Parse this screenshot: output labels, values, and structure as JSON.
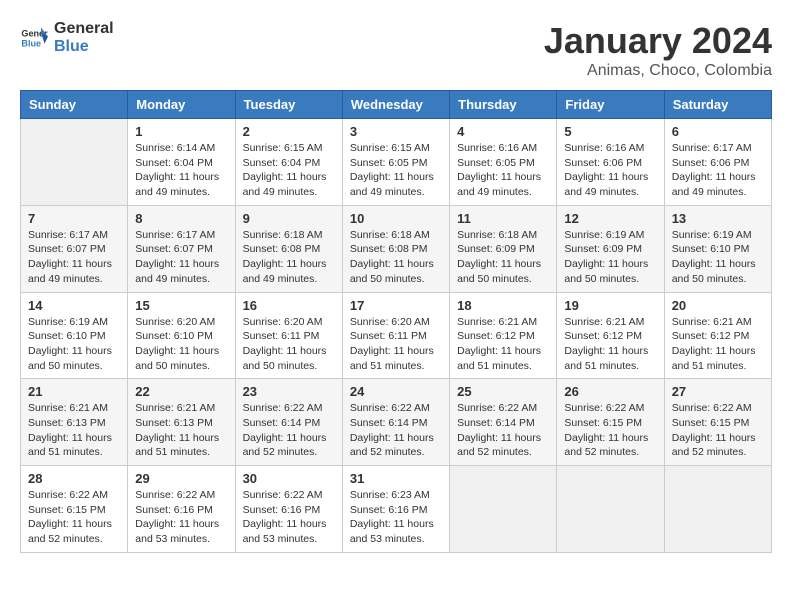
{
  "logo": {
    "text_general": "General",
    "text_blue": "Blue"
  },
  "title": "January 2024",
  "subtitle": "Animas, Choco, Colombia",
  "days_of_week": [
    "Sunday",
    "Monday",
    "Tuesday",
    "Wednesday",
    "Thursday",
    "Friday",
    "Saturday"
  ],
  "weeks": [
    [
      {
        "day": "",
        "detail": ""
      },
      {
        "day": "1",
        "detail": "Sunrise: 6:14 AM\nSunset: 6:04 PM\nDaylight: 11 hours\nand 49 minutes."
      },
      {
        "day": "2",
        "detail": "Sunrise: 6:15 AM\nSunset: 6:04 PM\nDaylight: 11 hours\nand 49 minutes."
      },
      {
        "day": "3",
        "detail": "Sunrise: 6:15 AM\nSunset: 6:05 PM\nDaylight: 11 hours\nand 49 minutes."
      },
      {
        "day": "4",
        "detail": "Sunrise: 6:16 AM\nSunset: 6:05 PM\nDaylight: 11 hours\nand 49 minutes."
      },
      {
        "day": "5",
        "detail": "Sunrise: 6:16 AM\nSunset: 6:06 PM\nDaylight: 11 hours\nand 49 minutes."
      },
      {
        "day": "6",
        "detail": "Sunrise: 6:17 AM\nSunset: 6:06 PM\nDaylight: 11 hours\nand 49 minutes."
      }
    ],
    [
      {
        "day": "7",
        "detail": "Sunrise: 6:17 AM\nSunset: 6:07 PM\nDaylight: 11 hours\nand 49 minutes."
      },
      {
        "day": "8",
        "detail": "Sunrise: 6:17 AM\nSunset: 6:07 PM\nDaylight: 11 hours\nand 49 minutes."
      },
      {
        "day": "9",
        "detail": "Sunrise: 6:18 AM\nSunset: 6:08 PM\nDaylight: 11 hours\nand 49 minutes."
      },
      {
        "day": "10",
        "detail": "Sunrise: 6:18 AM\nSunset: 6:08 PM\nDaylight: 11 hours\nand 50 minutes."
      },
      {
        "day": "11",
        "detail": "Sunrise: 6:18 AM\nSunset: 6:09 PM\nDaylight: 11 hours\nand 50 minutes."
      },
      {
        "day": "12",
        "detail": "Sunrise: 6:19 AM\nSunset: 6:09 PM\nDaylight: 11 hours\nand 50 minutes."
      },
      {
        "day": "13",
        "detail": "Sunrise: 6:19 AM\nSunset: 6:10 PM\nDaylight: 11 hours\nand 50 minutes."
      }
    ],
    [
      {
        "day": "14",
        "detail": "Sunrise: 6:19 AM\nSunset: 6:10 PM\nDaylight: 11 hours\nand 50 minutes."
      },
      {
        "day": "15",
        "detail": "Sunrise: 6:20 AM\nSunset: 6:10 PM\nDaylight: 11 hours\nand 50 minutes."
      },
      {
        "day": "16",
        "detail": "Sunrise: 6:20 AM\nSunset: 6:11 PM\nDaylight: 11 hours\nand 50 minutes."
      },
      {
        "day": "17",
        "detail": "Sunrise: 6:20 AM\nSunset: 6:11 PM\nDaylight: 11 hours\nand 51 minutes."
      },
      {
        "day": "18",
        "detail": "Sunrise: 6:21 AM\nSunset: 6:12 PM\nDaylight: 11 hours\nand 51 minutes."
      },
      {
        "day": "19",
        "detail": "Sunrise: 6:21 AM\nSunset: 6:12 PM\nDaylight: 11 hours\nand 51 minutes."
      },
      {
        "day": "20",
        "detail": "Sunrise: 6:21 AM\nSunset: 6:12 PM\nDaylight: 11 hours\nand 51 minutes."
      }
    ],
    [
      {
        "day": "21",
        "detail": "Sunrise: 6:21 AM\nSunset: 6:13 PM\nDaylight: 11 hours\nand 51 minutes."
      },
      {
        "day": "22",
        "detail": "Sunrise: 6:21 AM\nSunset: 6:13 PM\nDaylight: 11 hours\nand 51 minutes."
      },
      {
        "day": "23",
        "detail": "Sunrise: 6:22 AM\nSunset: 6:14 PM\nDaylight: 11 hours\nand 52 minutes."
      },
      {
        "day": "24",
        "detail": "Sunrise: 6:22 AM\nSunset: 6:14 PM\nDaylight: 11 hours\nand 52 minutes."
      },
      {
        "day": "25",
        "detail": "Sunrise: 6:22 AM\nSunset: 6:14 PM\nDaylight: 11 hours\nand 52 minutes."
      },
      {
        "day": "26",
        "detail": "Sunrise: 6:22 AM\nSunset: 6:15 PM\nDaylight: 11 hours\nand 52 minutes."
      },
      {
        "day": "27",
        "detail": "Sunrise: 6:22 AM\nSunset: 6:15 PM\nDaylight: 11 hours\nand 52 minutes."
      }
    ],
    [
      {
        "day": "28",
        "detail": "Sunrise: 6:22 AM\nSunset: 6:15 PM\nDaylight: 11 hours\nand 52 minutes."
      },
      {
        "day": "29",
        "detail": "Sunrise: 6:22 AM\nSunset: 6:16 PM\nDaylight: 11 hours\nand 53 minutes."
      },
      {
        "day": "30",
        "detail": "Sunrise: 6:22 AM\nSunset: 6:16 PM\nDaylight: 11 hours\nand 53 minutes."
      },
      {
        "day": "31",
        "detail": "Sunrise: 6:23 AM\nSunset: 6:16 PM\nDaylight: 11 hours\nand 53 minutes."
      },
      {
        "day": "",
        "detail": ""
      },
      {
        "day": "",
        "detail": ""
      },
      {
        "day": "",
        "detail": ""
      }
    ]
  ]
}
